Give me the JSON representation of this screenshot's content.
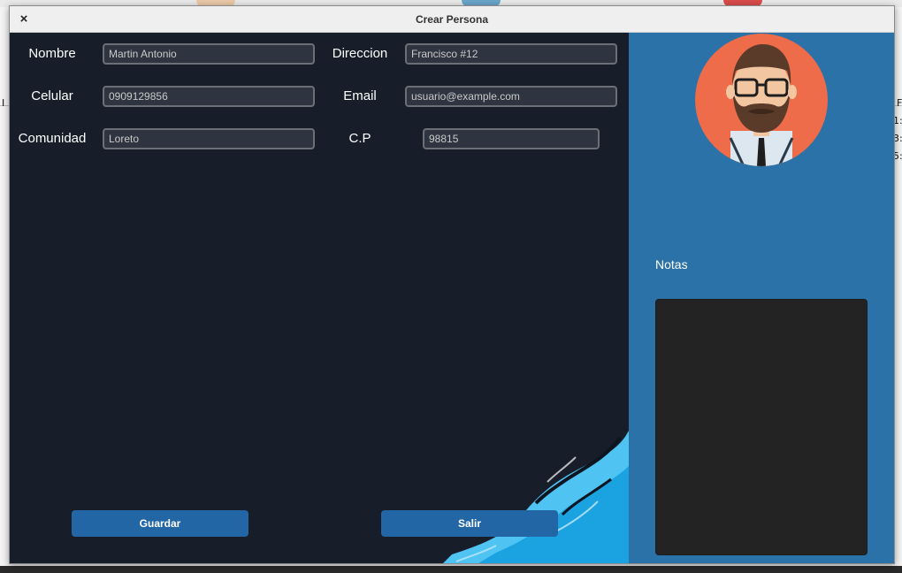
{
  "background_app": {
    "left_fragment": "I",
    "right_fragment": "F",
    "row_fragments": [
      "1:",
      "3:",
      "5:"
    ]
  },
  "dialog": {
    "title": "Crear Persona",
    "close_glyph": "×"
  },
  "form": {
    "nombre": {
      "label": "Nombre",
      "value": "Martin Antonio"
    },
    "direccion": {
      "label": "Direccion",
      "value": "Francisco #12"
    },
    "celular": {
      "label": "Celular",
      "value": "0909129856"
    },
    "email": {
      "label": "Email",
      "value": "usuario@example.com"
    },
    "comunidad": {
      "label": "Comunidad",
      "value": "Loreto"
    },
    "cp": {
      "label": "C.P",
      "value": "98815"
    }
  },
  "buttons": {
    "guardar": "Guardar",
    "salir": "Salir"
  },
  "side_panel": {
    "notes_label": "Notas",
    "avatar_icon": "bearded-man-avatar-icon"
  },
  "colors": {
    "form_bg": "#171e29",
    "side_bg": "#2a72a8",
    "button_bg": "#2366a6",
    "avatar_bg": "#ee6c4a"
  }
}
